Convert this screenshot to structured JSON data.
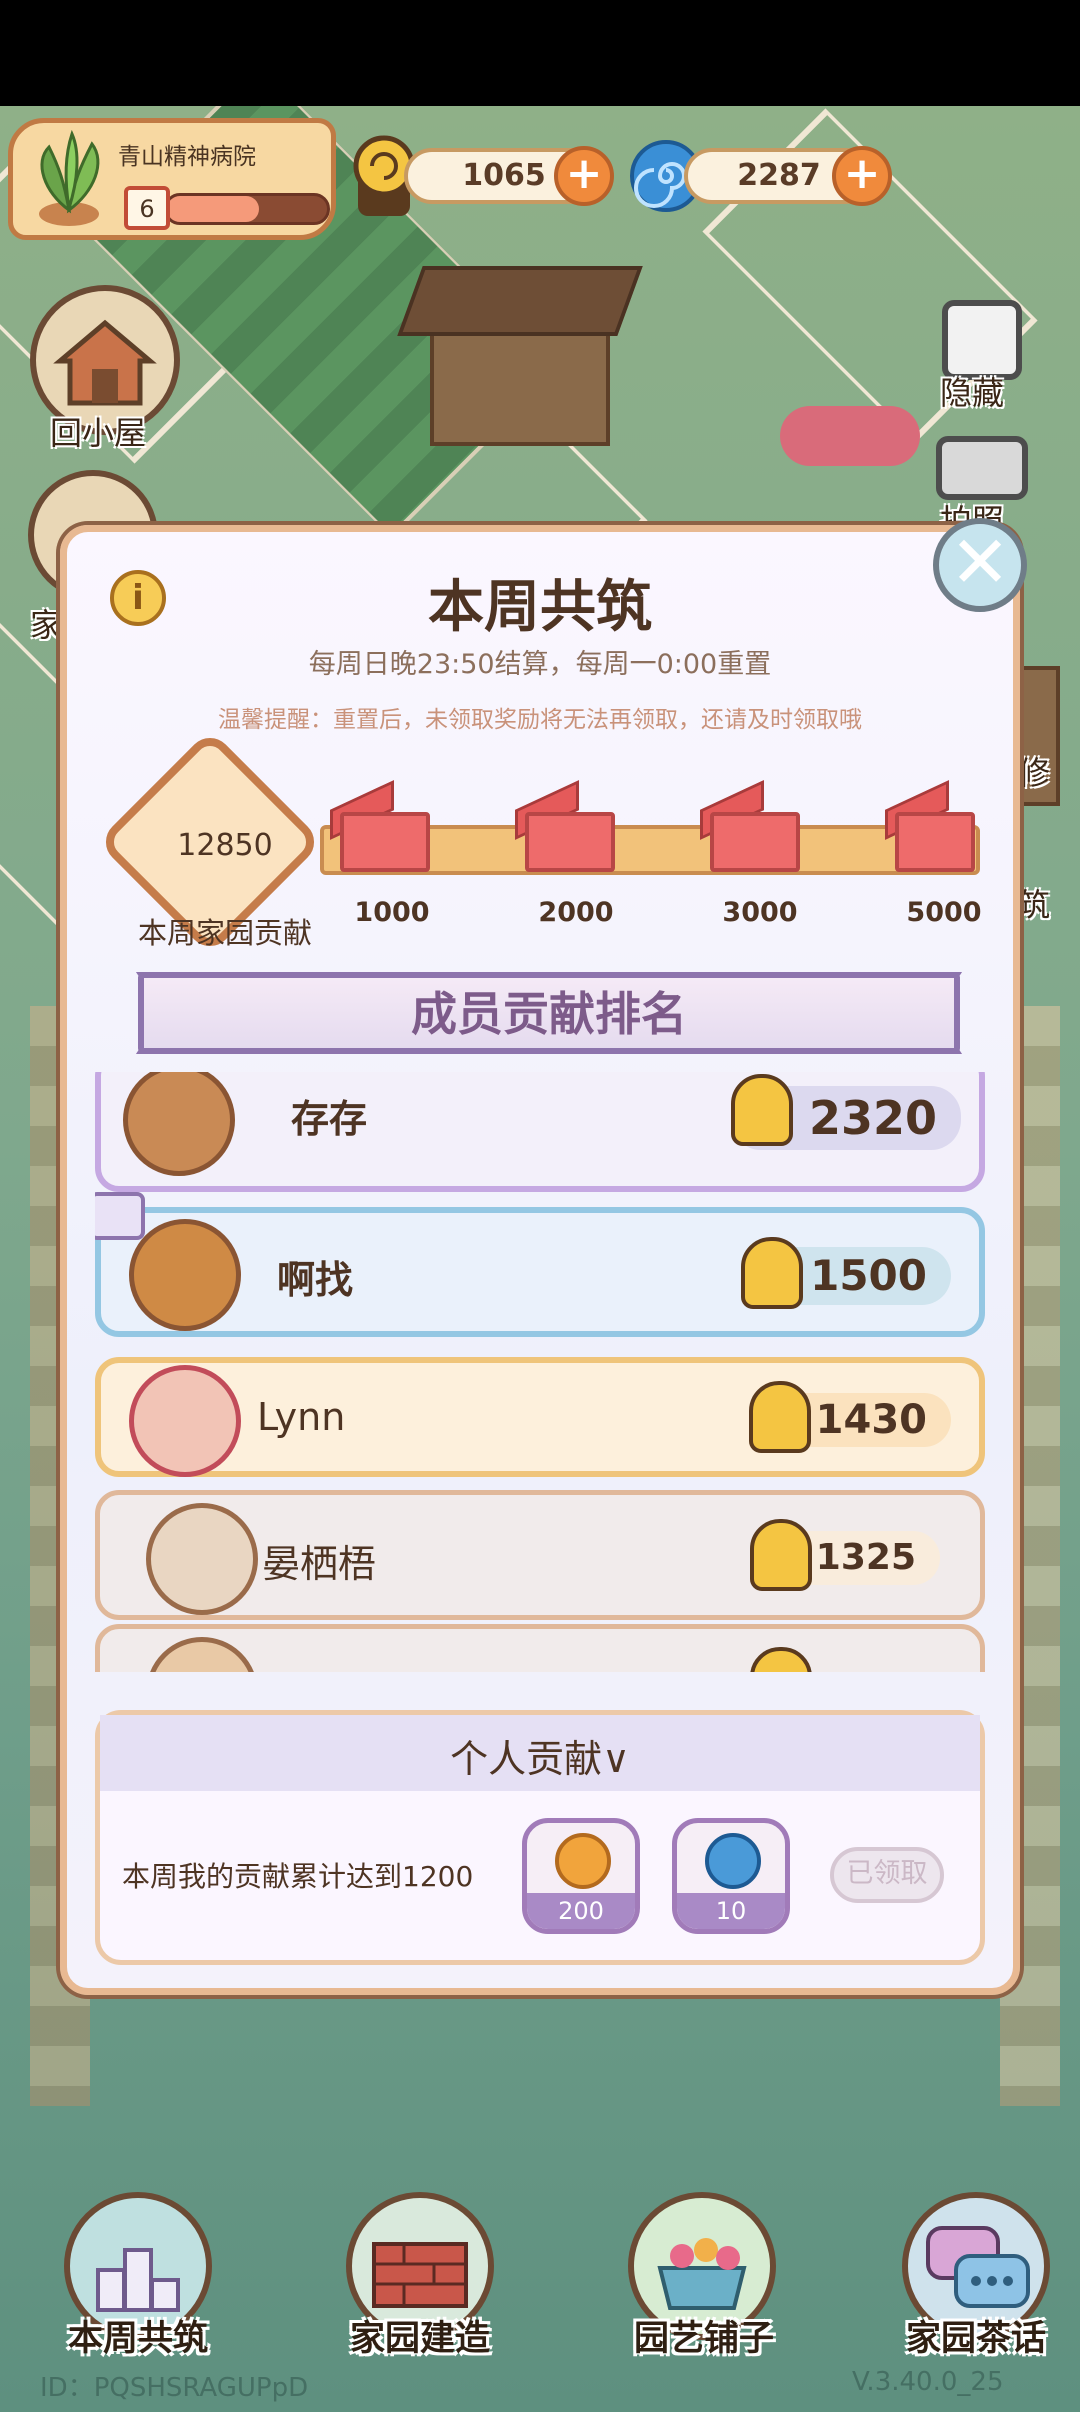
{
  "garden": {
    "name": "青山精神病院",
    "level": "6",
    "icon": "plant-icon"
  },
  "currency": {
    "snail_coins": "1065",
    "spirals": "2287",
    "plus_label": "+"
  },
  "side_buttons": {
    "home": "回小屋",
    "home_partial": "家",
    "hide": "隐藏",
    "photo": "拍照",
    "repair_partial": "修",
    "build_partial": "筑"
  },
  "modal": {
    "title": "本周共筑",
    "subtitle": "每周日晚23:50结算，每周一0:00重置",
    "tip": "温馨提醒：重置后，未领取奖励将无法再领取，还请及时领取哦",
    "info_label": "i",
    "close_label": "✕"
  },
  "progress": {
    "current": "12850",
    "current_label": "本周家园贡献",
    "milestones": [
      "1000",
      "2000",
      "3000",
      "5000"
    ]
  },
  "ranking": {
    "title": "成员贡献排名",
    "members": [
      {
        "name": "存存",
        "score": "2320"
      },
      {
        "name": "啊找",
        "score": "1500"
      },
      {
        "name": "Lynn",
        "score": "1430"
      },
      {
        "name": "晏栖梧",
        "score": "1325"
      }
    ]
  },
  "personal": {
    "title": "个人贡献∨",
    "desc": "本周我的贡献累计达到1200",
    "rewards": [
      {
        "qty": "200",
        "icon": "coin-icon"
      },
      {
        "qty": "10",
        "icon": "spiral-icon"
      }
    ],
    "claim_label": "已领取"
  },
  "nav": {
    "items": [
      "本周共筑",
      "家园建造",
      "园艺铺子",
      "家园茶话"
    ]
  },
  "footer": {
    "id": "ID：PQSHSRAGUPpD",
    "version": "V.3.40.0_25"
  },
  "colors": {
    "accent": "#c57c4a",
    "banner": "#8d74ad",
    "reward": "#a98ac6"
  }
}
